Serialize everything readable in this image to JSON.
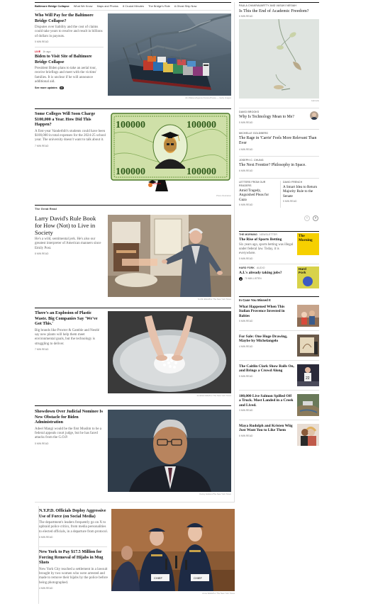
{
  "colors": {
    "accent_red": "#d0021b",
    "rule": "#121212",
    "light_rule": "#dfdfdf",
    "newsletter_yellow": "#f6d000"
  },
  "topnav": {
    "lead": "Baltimore Bridge Collapse",
    "items": [
      "What We Know",
      "Maps and Photos",
      "8 Crucial Minutes",
      "The Bridge's Role",
      "A Ghost Ship Now"
    ]
  },
  "story1": {
    "headline": "Who Will Pay for the Baltimore Bridge Collapse?",
    "summary": "Disputes over liability and the cost of claims could take years to resolve and result in billions of dollars in payouts.",
    "meta": "5 MIN READ",
    "credit": "Jim Watson/Agence France-Presse — Getty Images"
  },
  "story2": {
    "live_label": "LIVE",
    "live_time": "1h ago",
    "headline": "Biden to Visit Site of Baltimore Bridge Collapse",
    "summary": "President Biden plans to take an aerial tour, receive briefings and meet with the victims' families. It is unclear if he will announce additional aid.",
    "see_more": "See more updates",
    "see_more_count": "22"
  },
  "story3": {
    "headline": "Some Colleges Will Soon Charge $100,000 a Year. How Did This Happen?",
    "summary": "A first-year Vanderbilt's students could have been $100,000 in total expenses for the 2024-25 school year. The university doesn't want to talk about it.",
    "meta": "7 MIN READ",
    "bill_value": "100000",
    "credit": "Photo Illustration"
  },
  "great_read": {
    "kicker": "The Great Read",
    "headline": "Larry David's Rule Book for How (Not) to Live in Society",
    "summary": "He's a wild, sentimental jerk. He's also our greatest interpreter of American manners since Emily Post.",
    "meta": "8 MIN READ",
    "credit": "Ye Min Elliott/For The New York Times"
  },
  "story5": {
    "headline": "There's an Explosion of Plastic Waste. Big Companies Say 'We've Got This.'",
    "summary": "Big brands like Procter & Gamble and Nestlé say new plants will help them meet environmental goals, but the technology is struggling to deliver.",
    "meta": "7 MIN READ",
    "credit": "Jonathan Ellis/For The New York Times"
  },
  "story6": {
    "headline": "Showdown Over Judicial Nominee Is New Obstacle for Biden Administration",
    "summary": "Adeel Mangi would be the first Muslim to be a federal appeals court judge, but he has faced attacks from the G.O.P.",
    "meta": "5 MIN READ",
    "credit": "Kenny Holston/The New York Times"
  },
  "story7": {
    "headline": "N.Y.P.D. Officials Deploy Aggressive Use of Force (on Social Media)",
    "summary": "The department's leaders frequently go on X to upbraid police critics, from media personalities to elected officials, in a departure from protocol.",
    "meta": "6 MIN READ",
    "credit": "Anna Watts/For The New York Times",
    "signs": [
      "CHIEF",
      "CHIEF"
    ]
  },
  "story8": {
    "headline": "New York to Pay $17.5 Million for Forcing Removal of Hijabs in Mug Shots",
    "summary": "New York City reached a settlement in a lawsuit brought by two women who were arrested and made to remove their hijabs by the police before being photographed.",
    "meta": "4 MIN READ"
  },
  "opinion": {
    "top": {
      "byline": "Paula Chakravartty and Vasuki Nesiah",
      "headline": "Is This the End of Academic Freedom?",
      "meta": "6 MIN READ",
      "credit": "Gabrielle"
    },
    "items": [
      {
        "byline": "David Brooks",
        "headline": "Why Is Technology Mean to Me?",
        "meta": "5 MIN READ"
      },
      {
        "byline": "Michelle Goldberg",
        "headline": "The Rage in 'Carrie' Feels More Relevant Than Ever",
        "meta": "4 MIN READ"
      },
      {
        "byline": "Joseph C. Chung",
        "headline": "The Next Frontier? Philosophy in Space.",
        "meta": "6 MIN READ"
      }
    ],
    "pair": [
      {
        "byline": "Letters From Our Readers",
        "headline": "Amid Tragedy, Anguished Pleas for Gaza",
        "meta": "6 MIN READ"
      },
      {
        "byline": "David French",
        "headline": "A Smart Idea to Return Majority Rule to the Senate",
        "meta": "5 MIN READ"
      }
    ]
  },
  "carousel": {
    "prev": "‹",
    "next": "›"
  },
  "newsletter": {
    "tag": "The Morning",
    "label": "Newsletter",
    "headline": "The Rise of Sports Betting",
    "summary": "Six years ago, sports betting was illegal under federal law. Today, it is everywhere.",
    "meta": "5 MIN READ",
    "tile": "The Morning"
  },
  "podcast": {
    "tag": "Hard Fork",
    "label": "Audio",
    "headline": "A.I.'s already taking jobs?",
    "meta": "70 MIN LISTEN",
    "tile": "Hard Fork"
  },
  "missed": {
    "title": "In Case You Missed It",
    "items": [
      {
        "headline": "What Happened When This Italian Provence Invested in Babies",
        "meta": "5 MIN READ"
      },
      {
        "headline": "For Sale: One Huge Drawing, Maybe by Michelangelo",
        "meta": "4 MIN READ"
      },
      {
        "headline": "The Caitlin Clark Show Rolls On, and Brings a Crowd Along",
        "meta": "5 MIN READ"
      },
      {
        "headline": "100,000 Live Salmon Spilled Off a Truck. Most Landed in a Creek and Lived.",
        "meta": "3 MIN READ"
      },
      {
        "headline": "Maya Rudolph and Kristen Wiig Just Want You to Like Them",
        "meta": "6 MIN READ"
      }
    ]
  }
}
